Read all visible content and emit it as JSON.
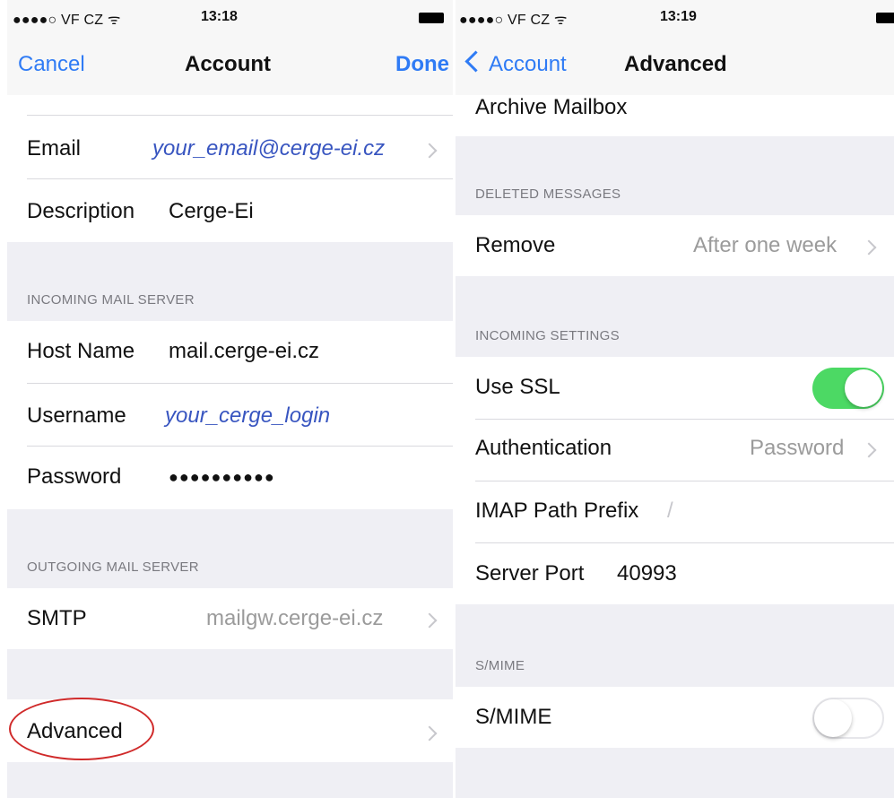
{
  "left": {
    "status": {
      "carrier": "●●●●○ VF CZ ᯤ",
      "time": "13:18"
    },
    "nav": {
      "cancel": "Cancel",
      "title": "Account",
      "done": "Done"
    },
    "account": {
      "email_label": "Email",
      "email_value": "your_email@cerge-ei.cz",
      "description_label": "Description",
      "description_value": "Cerge-Ei"
    },
    "incoming": {
      "header": "INCOMING MAIL SERVER",
      "host_label": "Host Name",
      "host_value": "mail.cerge-ei.cz",
      "username_label": "Username",
      "username_value": "your_cerge_login",
      "password_label": "Password",
      "password_value": "●●●●●●●●●●"
    },
    "outgoing": {
      "header": "OUTGOING MAIL SERVER",
      "smtp_label": "SMTP",
      "smtp_value": "mailgw.cerge-ei.cz"
    },
    "advanced_label": "Advanced"
  },
  "right": {
    "status": {
      "carrier": "●●●●○ VF CZ ᯤ",
      "time": "13:19"
    },
    "nav": {
      "back": "Account",
      "title": "Advanced"
    },
    "archive_label": "Archive Mailbox",
    "deleted": {
      "header": "DELETED MESSAGES",
      "remove_label": "Remove",
      "remove_value": "After one week"
    },
    "incoming_settings": {
      "header": "INCOMING SETTINGS",
      "ssl_label": "Use SSL",
      "ssl_on": true,
      "auth_label": "Authentication",
      "auth_value": "Password",
      "imap_label": "IMAP Path Prefix",
      "imap_value": "/",
      "port_label": "Server Port",
      "port_value": "40993"
    },
    "smime": {
      "header": "S/MIME",
      "smime_label": "S/MIME",
      "smime_on": false
    }
  },
  "colors": {
    "accent": "#2f7bf5",
    "toggle_on": "#4cd964",
    "highlight_circle": "#d02a2a"
  }
}
